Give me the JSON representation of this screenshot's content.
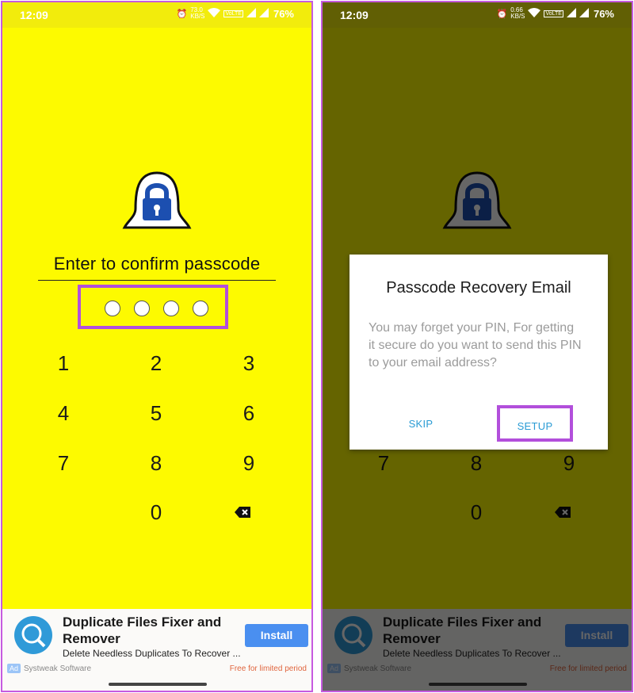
{
  "status_bar": {
    "time": "12:09",
    "battery": "76%",
    "left_speed": "73.0\nKB/S",
    "right_speed": "0.66\nKB/S"
  },
  "lock_screen": {
    "title": "Enter to confirm passcode",
    "keys": [
      "1",
      "2",
      "3",
      "4",
      "5",
      "6",
      "7",
      "8",
      "9",
      "0"
    ]
  },
  "dialog": {
    "title": "Passcode Recovery Email",
    "body": "You may forget your PIN, For getting it secure do you want to send this PIN to your email address?",
    "skip_label": "SKIP",
    "setup_label": "SETUP"
  },
  "ad": {
    "title": "Duplicate Files Fixer and Remover",
    "subtitle": "Delete Needless Duplicates To Recover ...",
    "install_label": "Install",
    "badge": "Ad",
    "brand": "Systweak Software",
    "offer": "Free for limited period"
  },
  "colors": {
    "background": "#fdfa00",
    "highlight": "#b24fdb",
    "dialog_button": "#2a9bd4",
    "install": "#4a8ff0"
  },
  "icons": [
    "alarm-icon",
    "wifi-icon",
    "volte-icon",
    "signal-icon",
    "battery-icon",
    "padlock-ghost-icon",
    "backspace-icon"
  ]
}
